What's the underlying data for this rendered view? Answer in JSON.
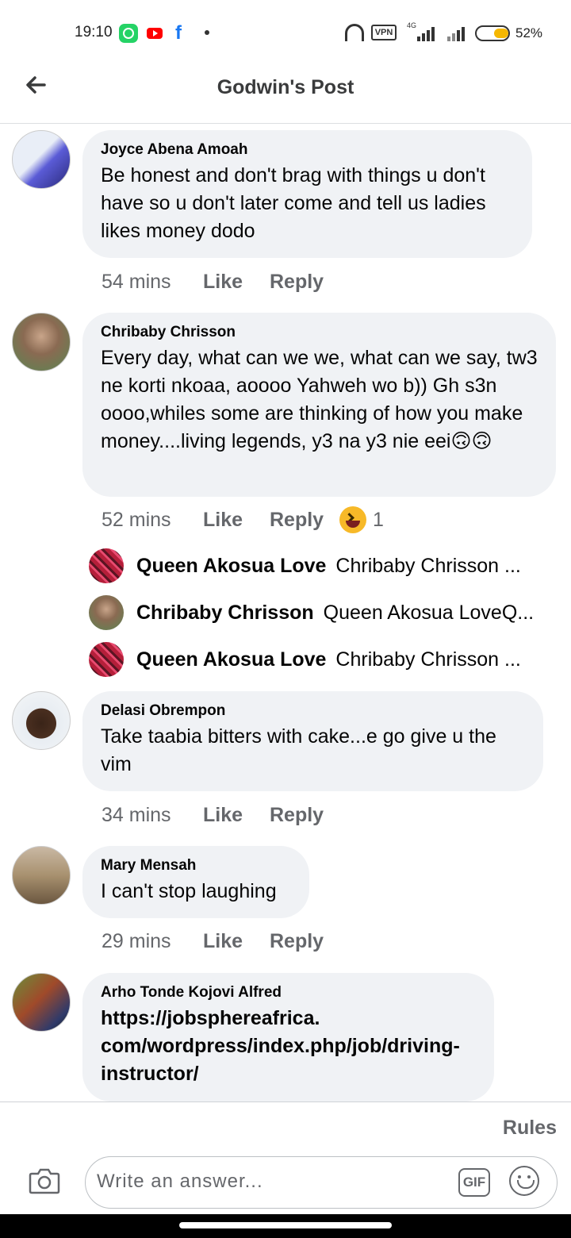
{
  "status_bar": {
    "time": "19:10",
    "vpn": "VPN",
    "network": "4G",
    "battery": "52%",
    "battery_level": 52,
    "icons": [
      "whatsapp-icon",
      "youtube-icon",
      "facebook-icon",
      "dot-icon",
      "headphones-icon",
      "vpn-icon",
      "signal-icon",
      "battery-icon"
    ]
  },
  "header": {
    "title": "Godwin's Post"
  },
  "comments": [
    {
      "author": "Joyce Abena Amoah",
      "text": "Be honest and don't brag with things u don't have so u don't later come and tell us ladies likes money dodo",
      "time": "54 mins",
      "like": "Like",
      "reply": "Reply"
    },
    {
      "author": "Chribaby Chrisson",
      "text": "Every day, what can we we, what can we say, tw3 ne korti nkoaa, aoooo Yahweh wo b)) Gh s3n oooo,whiles some are thinking of how you make money....living legends, y3 na y3 nie eei🙃🙃",
      "time": "52 mins",
      "like": "Like",
      "reply": "Reply",
      "reaction_count": "1"
    },
    {
      "author": "Delasi Obrempon",
      "text": "Take taabia bitters with cake...e go give u the vim",
      "time": "34 mins",
      "like": "Like",
      "reply": "Reply"
    },
    {
      "author": "Mary Mensah",
      "text": "I can't stop laughing",
      "time": "29 mins",
      "like": "Like",
      "reply": "Reply"
    },
    {
      "author": "Arho Tonde Kojovi Alfred",
      "text": "https://jobsphereafrica.\ncom/wordpress/index.php/job/driving-\ninstructor/"
    }
  ],
  "replies": [
    {
      "author": "Queen Akosua Love",
      "snippet": "Chribaby Chrisson ..."
    },
    {
      "author": "Chribaby Chrisson",
      "snippet": "Queen Akosua LoveQ..."
    },
    {
      "author": "Queen Akosua Love",
      "snippet": "Chribaby Chrisson ..."
    }
  ],
  "composer": {
    "rules": "Rules",
    "placeholder": "Write an answer...",
    "gif": "GIF"
  },
  "colors": {
    "bubble": "#f0f2f5",
    "meta_text": "#65676b",
    "facebook_blue": "#1877f2",
    "haha_yellow": "#f7b928"
  }
}
